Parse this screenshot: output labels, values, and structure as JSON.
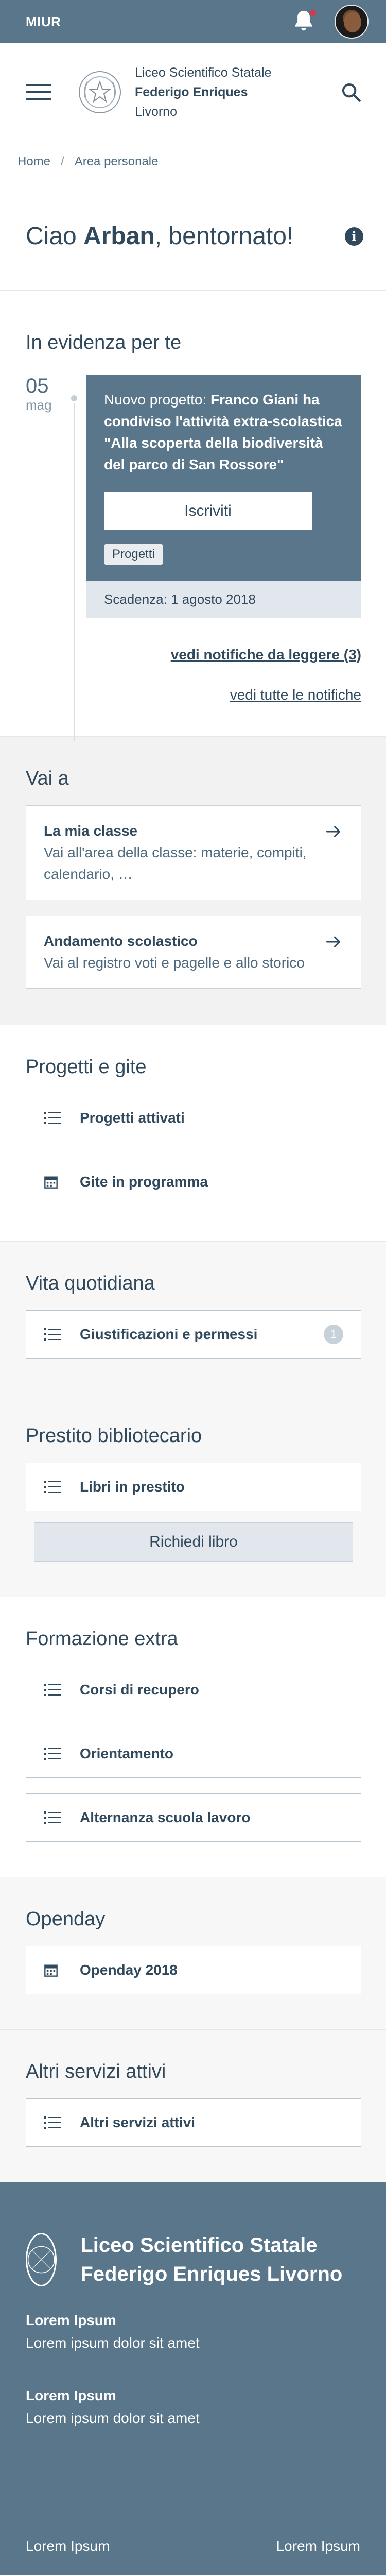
{
  "topbar": {
    "brand": "MIUR"
  },
  "header": {
    "school_line1": "Liceo Scientifico Statale",
    "school_line2": "Federigo Enriques",
    "school_line3": "Livorno"
  },
  "breadcrumb": {
    "home": "Home",
    "separator": "/",
    "current": "Area personale"
  },
  "greeting": {
    "prefix": "Ciao ",
    "name": "Arban",
    "suffix": ", bentornato!",
    "info": "i"
  },
  "evidenza": {
    "title": "In evidenza per te",
    "date_day": "05",
    "date_month": "mag",
    "card_prefix": "Nuovo progetto: ",
    "card_bold": "Franco Giani ha condiviso l'attività extra-scolastica \"Alla scoperta della biodiversità del parco di San Rossore\"",
    "button": "Iscriviti",
    "tag": "Progetti",
    "deadline": "Scadenza: 1 agosto 2018",
    "link_unread": "vedi notifiche da leggere (3)",
    "link_all": "vedi tutte le notifiche"
  },
  "vaia": {
    "title": "Vai a",
    "items": [
      {
        "title": "La mia classe",
        "desc": "Vai all'area della classe: materie, compiti, calendario, …"
      },
      {
        "title": "Andamento scolastico",
        "desc": "Vai al registro voti e pagelle e allo storico"
      }
    ]
  },
  "progetti": {
    "title": "Progetti e gite",
    "items": [
      {
        "label": "Progetti attivati",
        "icon": "list-icon"
      },
      {
        "label": "Gite in programma",
        "icon": "calendar-icon"
      }
    ]
  },
  "vita": {
    "title": "Vita quotidiana",
    "items": [
      {
        "label": "Giustificazioni e permessi",
        "icon": "list-icon",
        "badge": "1"
      }
    ]
  },
  "prestito": {
    "title": "Prestito bibliotecario",
    "items": [
      {
        "label": "Libri in prestito",
        "icon": "list-icon"
      }
    ],
    "button": "Richiedi libro"
  },
  "formazione": {
    "title": "Formazione extra",
    "items": [
      {
        "label": "Corsi di recupero",
        "icon": "list-icon"
      },
      {
        "label": "Orientamento",
        "icon": "list-icon"
      },
      {
        "label": "Alternanza scuola lavoro",
        "icon": "list-icon"
      }
    ]
  },
  "openday": {
    "title": "Openday",
    "items": [
      {
        "label": "Openday 2018",
        "icon": "calendar-icon"
      }
    ]
  },
  "altri": {
    "title": "Altri servizi attivi",
    "items": [
      {
        "label": "Altri servizi attivi",
        "icon": "list-icon"
      }
    ]
  },
  "footer": {
    "name": "Liceo Scientifico Statale Federigo Enriques Livorno",
    "items": [
      {
        "heading": "Lorem Ipsum",
        "text": "Lorem ipsum dolor sit amet"
      },
      {
        "heading": "Lorem Ipsum",
        "text": "Lorem ipsum dolor sit amet"
      }
    ],
    "bottom_left": "Lorem Ipsum",
    "bottom_right": "Lorem Ipsum"
  },
  "colors": {
    "primary": "#5a768a",
    "text": "#30495c",
    "notification": "#d9364f",
    "panel": "#f2f2f2"
  }
}
